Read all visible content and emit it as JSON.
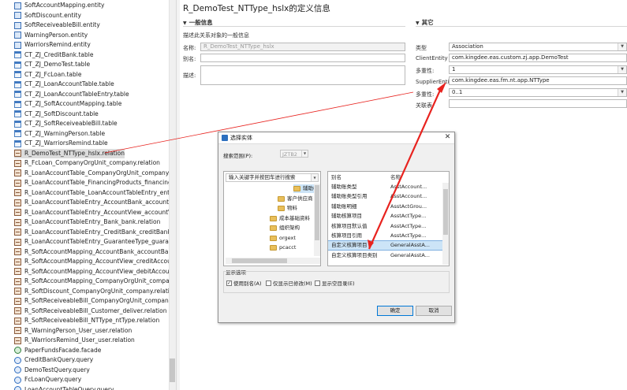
{
  "left_tree": {
    "items": [
      {
        "label": "SoftAccountMapping.entity",
        "kind": "entity"
      },
      {
        "label": "SoftDiscount.entity",
        "kind": "entity"
      },
      {
        "label": "SoftReceiveableBill.entity",
        "kind": "entity"
      },
      {
        "label": "WarningPerson.entity",
        "kind": "entity"
      },
      {
        "label": "WarriorsRemind.entity",
        "kind": "entity"
      },
      {
        "label": "CT_ZJ_CreditBank.table",
        "kind": "table"
      },
      {
        "label": "CT_ZJ_DemoTest.table",
        "kind": "table"
      },
      {
        "label": "CT_ZJ_FcLoan.table",
        "kind": "table"
      },
      {
        "label": "CT_ZJ_LoanAccountTable.table",
        "kind": "table"
      },
      {
        "label": "CT_ZJ_LoanAccountTableEntry.table",
        "kind": "table"
      },
      {
        "label": "CT_ZJ_SoftAccountMapping.table",
        "kind": "table"
      },
      {
        "label": "CT_ZJ_SoftDiscount.table",
        "kind": "table"
      },
      {
        "label": "CT_ZJ_SoftReceiveableBill.table",
        "kind": "table"
      },
      {
        "label": "CT_ZJ_WarningPerson.table",
        "kind": "table"
      },
      {
        "label": "CT_ZJ_WarriorsRemind.table",
        "kind": "table"
      },
      {
        "label": "R_DemoTest_NTType_hslx.relation",
        "kind": "relation",
        "selected": true
      },
      {
        "label": "R_FcLoan_CompanyOrgUnit_company.relation",
        "kind": "relation"
      },
      {
        "label": "R_LoanAccountTable_CompanyOrgUnit_company.relation",
        "kind": "relation"
      },
      {
        "label": "R_LoanAccountTable_FinancingProducts_financingProducts.relati",
        "kind": "relation"
      },
      {
        "label": "R_LoanAccountTable_LoanAccountTableEntry_entrys.relation",
        "kind": "relation"
      },
      {
        "label": "R_LoanAccountTableEntry_AccountBank_accountBank.relation",
        "kind": "relation"
      },
      {
        "label": "R_LoanAccountTableEntry_AccountView_accountView.relation",
        "kind": "relation"
      },
      {
        "label": "R_LoanAccountTableEntry_Bank_bank.relation",
        "kind": "relation"
      },
      {
        "label": "R_LoanAccountTableEntry_CreditBank_creditBank.relation",
        "kind": "relation"
      },
      {
        "label": "R_LoanAccountTableEntry_GuaranteeType_guaranteeType.rela",
        "kind": "relation"
      },
      {
        "label": "R_SoftAccountMapping_AccountBank_accountBank.relation",
        "kind": "relation"
      },
      {
        "label": "R_SoftAccountMapping_AccountView_creditAccount.relation",
        "kind": "relation"
      },
      {
        "label": "R_SoftAccountMapping_AccountView_debitAccount.relation",
        "kind": "relation"
      },
      {
        "label": "R_SoftAccountMapping_CompanyOrgUnit_company.relation",
        "kind": "relation"
      },
      {
        "label": "R_SoftDiscount_CompanyOrgUnit_company.relation",
        "kind": "relation"
      },
      {
        "label": "R_SoftReceiveableBill_CompanyOrgUnit_company.relation",
        "kind": "relation"
      },
      {
        "label": "R_SoftReceiveableBill_Customer_deliver.relation",
        "kind": "relation"
      },
      {
        "label": "R_SoftReceiveableBill_NTType_ntType.relation",
        "kind": "relation"
      },
      {
        "label": "R_WarningPerson_User_user.relation",
        "kind": "relation"
      },
      {
        "label": "R_WarriorsRemind_User_user.relation",
        "kind": "relation"
      },
      {
        "label": "PaperFundsFacade.facade",
        "kind": "facade"
      },
      {
        "label": "CreditBankQuery.query",
        "kind": "query"
      },
      {
        "label": "DemoTestQuery.query",
        "kind": "query"
      },
      {
        "label": "FcLoanQuery.query",
        "kind": "query"
      },
      {
        "label": "LoanAccountTableQuery.query",
        "kind": "query"
      }
    ]
  },
  "editor": {
    "title": "R_DemoTest_NTType_hslx的定义信息",
    "general": {
      "heading": "一般信息",
      "description": "描述此关系对象的一般信息",
      "name_label": "名称:",
      "name_value": "R_DemoTest_NTType_hslx",
      "alias_label": "别名:",
      "alias_value": "",
      "desc_label": "描述:",
      "desc_value": ""
    },
    "other": {
      "heading": "其它",
      "type_label": "类型",
      "type_value": "Association",
      "client_label": "ClientEntity",
      "client_value": "com.kingdee.eas.custom.zj.app.DemoTest",
      "multi1_label": "多重性:",
      "multi1_value": "1",
      "supplier_label": "SupplierEntity",
      "supplier_value": "com.kingdee.eas.fm.nt.app.NTType",
      "multi2_label": "多重性:",
      "multi2_value": "0..1",
      "assoc_label": "关联表",
      "assoc_value": ""
    }
  },
  "dialog": {
    "title": "选择实体",
    "scope_label": "搜索范围(P):",
    "scope_value": "JZTB2",
    "search_value": "输入关键字并按回车进行搜索",
    "tree": [
      {
        "label": "辅助核算",
        "selected": true
      },
      {
        "label": "客户供应商"
      },
      {
        "label": "物料"
      },
      {
        "label": "成本基础资料"
      },
      {
        "label": "组织架构"
      },
      {
        "label": "orgext"
      },
      {
        "label": "pcacct"
      }
    ],
    "list_headers": [
      "别名",
      "名称"
    ],
    "list": [
      {
        "alias": "辅助账类型",
        "name": "AsstAccount..."
      },
      {
        "alias": "辅助账类型引用",
        "name": "AsstAccount..."
      },
      {
        "alias": "辅助账明细",
        "name": "AsstActGrou..."
      },
      {
        "alias": "辅助核算项目",
        "name": "AsstActType..."
      },
      {
        "alias": "核算项目默认值",
        "name": "AsstActType..."
      },
      {
        "alias": "核算项目引用",
        "name": "AsstActType..."
      },
      {
        "alias": "自定义核算项目",
        "name": "GeneralAsstA...",
        "selected": true
      },
      {
        "alias": "自定义核算项目类别",
        "name": "GeneralAsstA..."
      }
    ],
    "options_label": "显示选项",
    "opt_alias": "使用别名(A)",
    "opt_modified": "仅显示已修改(M)",
    "opt_empty": "显示空目录(E)",
    "ok_label": "确定",
    "cancel_label": "取消"
  },
  "colors": {
    "arrow": "#e8231f",
    "selection": "#cce4f7"
  }
}
